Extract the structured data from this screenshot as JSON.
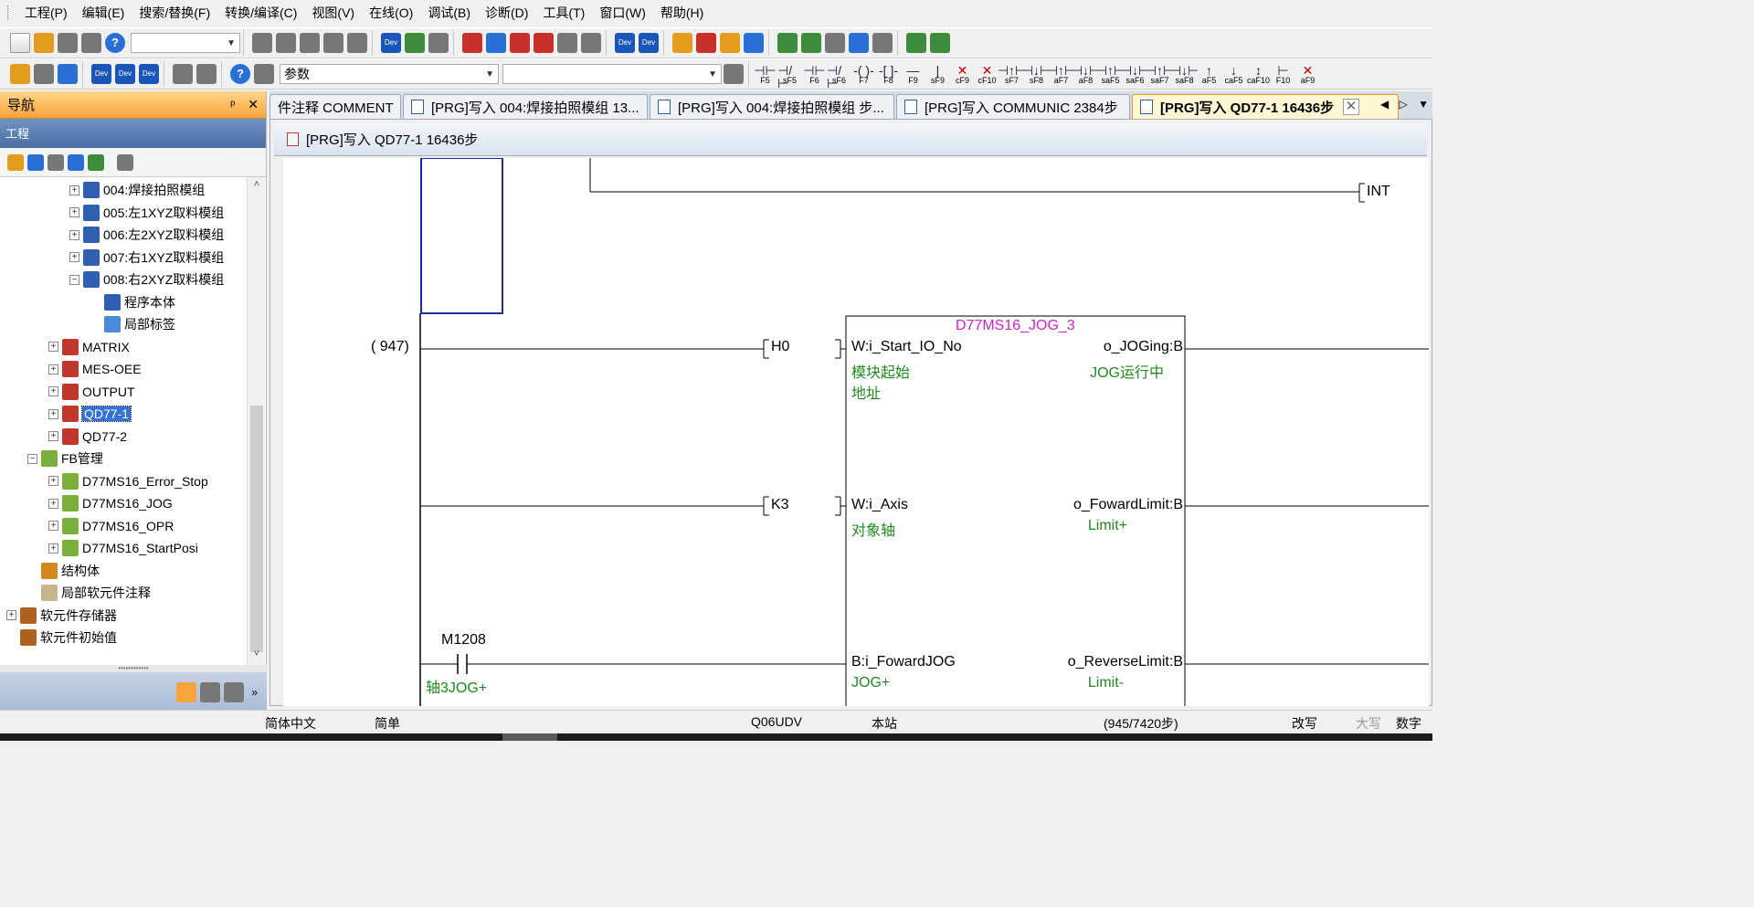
{
  "menu": [
    "工程(P)",
    "编辑(E)",
    "搜索/替换(F)",
    "转换/编译(C)",
    "视图(V)",
    "在线(O)",
    "调试(B)",
    "诊断(D)",
    "工具(T)",
    "窗口(W)",
    "帮助(H)"
  ],
  "toolbar2": {
    "search_value": "参数"
  },
  "fkeys": [
    {
      "sym": "⊣⊢",
      "label": "F5"
    },
    {
      "sym": "⊣/⊢",
      "label": "sF5"
    },
    {
      "sym": "⊣⊢",
      "label": "F6"
    },
    {
      "sym": "⊣/⊢",
      "label": "sF6"
    },
    {
      "sym": "-( )-",
      "label": "F7"
    },
    {
      "sym": "-[ ]-",
      "label": "F8"
    },
    {
      "sym": "—",
      "label": "F9"
    },
    {
      "sym": "|",
      "label": "sF9"
    },
    {
      "sym": "✕",
      "label": "cF9",
      "red": true
    },
    {
      "sym": "✕",
      "label": "cF10",
      "red": true
    },
    {
      "sym": "⊣↑⊢",
      "label": "sF7"
    },
    {
      "sym": "⊣↓⊢",
      "label": "sF8"
    },
    {
      "sym": "⊣↑⊢",
      "label": "aF7"
    },
    {
      "sym": "⊣↓⊢",
      "label": "aF8"
    },
    {
      "sym": "⊣↑⊢",
      "label": "saF5"
    },
    {
      "sym": "⊣↓⊢",
      "label": "saF6"
    },
    {
      "sym": "⊣↑⊢",
      "label": "saF7"
    },
    {
      "sym": "⊣↓⊢",
      "label": "saF8"
    },
    {
      "sym": "↑",
      "label": "aF5"
    },
    {
      "sym": "↓",
      "label": "caF5"
    },
    {
      "sym": "↕",
      "label": "caF10"
    },
    {
      "sym": "⊢",
      "label": "F10"
    },
    {
      "sym": "✕",
      "label": "aF9",
      "red": true
    }
  ],
  "nav": {
    "title": "导航",
    "pin": "ᵖ",
    "close": "✕",
    "project_label": "工程",
    "tree": [
      {
        "label": "004:焊接拍照模组",
        "exp": "+",
        "icon": "prog"
      },
      {
        "label": "005:左1XYZ取料模组",
        "exp": "+",
        "icon": "prog"
      },
      {
        "label": "006:左2XYZ取料模组",
        "exp": "+",
        "icon": "prog"
      },
      {
        "label": "007:右1XYZ取料模组",
        "exp": "+",
        "icon": "prog"
      },
      {
        "label": "008:右2XYZ取料模组",
        "exp": "−",
        "icon": "prog"
      },
      {
        "label": "程序本体",
        "exp": "",
        "icon": "prog"
      },
      {
        "label": "局部标签",
        "exp": "",
        "icon": "tag"
      },
      {
        "label": "MATRIX",
        "exp": "+",
        "icon": "ld"
      },
      {
        "label": "MES-OEE",
        "exp": "+",
        "icon": "ld"
      },
      {
        "label": "OUTPUT",
        "exp": "+",
        "icon": "ld"
      },
      {
        "label": "QD77-1",
        "exp": "+",
        "icon": "ld",
        "selected": true
      },
      {
        "label": "QD77-2",
        "exp": "+",
        "icon": "ld"
      },
      {
        "label": "FB管理",
        "exp": "−",
        "icon": "folder"
      },
      {
        "label": "D77MS16_Error_Stop",
        "exp": "+",
        "icon": "folder"
      },
      {
        "label": "D77MS16_JOG",
        "exp": "+",
        "icon": "folder"
      },
      {
        "label": "D77MS16_OPR",
        "exp": "+",
        "icon": "folder"
      },
      {
        "label": "D77MS16_StartPosi",
        "exp": "+",
        "icon": "folder"
      },
      {
        "label": "结构体",
        "exp": "",
        "icon": "struct"
      },
      {
        "label": "局部软元件注释",
        "exp": "",
        "icon": "cmt"
      },
      {
        "label": "软元件存储器",
        "exp": "+",
        "icon": "mem"
      },
      {
        "label": "软元件初始值",
        "exp": "",
        "icon": "mem"
      }
    ]
  },
  "tabs": [
    {
      "label": "件注释 COMMENT"
    },
    {
      "label": "[PRG]写入 004:焊接拍照模组 13..."
    },
    {
      "label": "[PRG]写入 004:焊接拍照模组 步..."
    },
    {
      "label": "[PRG]写入 COMMUNIC 2384步"
    },
    {
      "label": "[PRG]写入 QD77-1 16436步",
      "active": true
    }
  ],
  "editor": {
    "title": "[PRG]写入 QD77-1 16436步",
    "step": "( 947)",
    "int_label": "INT",
    "fb_name": "D77MS16_JOG_3",
    "h0": "H0",
    "k3": "K3",
    "m_contact": "M1208",
    "m_comment": "轴3JOG+",
    "in1": "W:i_Start_IO_No",
    "in1_c1": "模块起始",
    "in1_c2": "地址",
    "in2": "W:i_Axis",
    "in2_c": "对象轴",
    "in3": "B:i_FowardJOG",
    "in3_c": "JOG+",
    "out1": "o_JOGing:B",
    "out1_c": "JOG运行中",
    "out2": "o_FowardLimit:B",
    "out2_c": "Limit+",
    "out3": "o_ReverseLimit:B",
    "out3_c": "Limit-"
  },
  "status": {
    "lang": "简体中文",
    "mode": "简单",
    "cpu": "Q06UDV",
    "station": "本站",
    "steps": "(945/7420步)",
    "overwrite": "改写",
    "caps": "大写",
    "num": "数字"
  }
}
